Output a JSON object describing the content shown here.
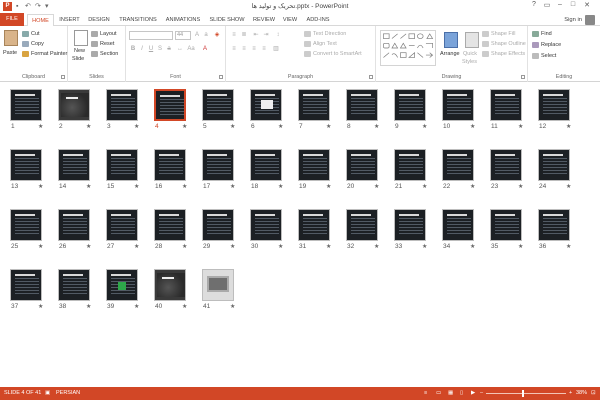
{
  "app": {
    "window_title": "تحریک و تولید ها.pptx - PowerPoint",
    "logo_letter": "P",
    "window_controls": [
      "?",
      "▭",
      "–",
      "□",
      "✕"
    ],
    "qat_icons": [
      "save-icon",
      "undo-icon",
      "redo-icon",
      "customize-icon"
    ],
    "sign_in": "Sign in"
  },
  "tabs": [
    "FILE",
    "HOME",
    "INSERT",
    "DESIGN",
    "TRANSITIONS",
    "ANIMATIONS",
    "SLIDE SHOW",
    "REVIEW",
    "VIEW",
    "ADD-INS"
  ],
  "active_tab": "HOME",
  "ribbon": {
    "clipboard": {
      "label": "Clipboard",
      "paste": "Paste",
      "cut": "Cut",
      "copy": "Copy",
      "format_painter": "Format Painter"
    },
    "slides": {
      "label": "Slides",
      "new_slide_line1": "New",
      "new_slide_line2": "Slide",
      "layout": "Layout",
      "reset": "Reset",
      "section": "Section"
    },
    "font": {
      "label": "Font",
      "size": "44"
    },
    "paragraph": {
      "label": "Paragraph",
      "text_direction": "Text Direction",
      "align_text": "Align Text",
      "convert_smartart": "Convert to SmartArt"
    },
    "drawing": {
      "label": "Drawing",
      "arrange": "Arrange",
      "quick_styles_line1": "Quick",
      "quick_styles_line2": "Styles",
      "shape_fill": "Shape Fill",
      "shape_outline": "Shape Outline",
      "shape_effects": "Shape Effects"
    },
    "editing": {
      "label": "Editing",
      "find": "Find",
      "replace": "Replace",
      "select": "Select"
    }
  },
  "slides": {
    "selected": 4,
    "items": [
      {
        "num": "1",
        "kind": "title"
      },
      {
        "num": "2",
        "kind": "photo"
      },
      {
        "num": "3",
        "kind": "text"
      },
      {
        "num": "4",
        "kind": "text"
      },
      {
        "num": "5",
        "kind": "text"
      },
      {
        "num": "6",
        "kind": "paper"
      },
      {
        "num": "7",
        "kind": "text"
      },
      {
        "num": "8",
        "kind": "text"
      },
      {
        "num": "9",
        "kind": "text"
      },
      {
        "num": "10",
        "kind": "text"
      },
      {
        "num": "11",
        "kind": "text"
      },
      {
        "num": "12",
        "kind": "text"
      },
      {
        "num": "13",
        "kind": "text"
      },
      {
        "num": "14",
        "kind": "text"
      },
      {
        "num": "15",
        "kind": "text"
      },
      {
        "num": "16",
        "kind": "text"
      },
      {
        "num": "17",
        "kind": "text"
      },
      {
        "num": "18",
        "kind": "text"
      },
      {
        "num": "19",
        "kind": "text"
      },
      {
        "num": "20",
        "kind": "text"
      },
      {
        "num": "21",
        "kind": "text"
      },
      {
        "num": "22",
        "kind": "text"
      },
      {
        "num": "23",
        "kind": "text"
      },
      {
        "num": "24",
        "kind": "text"
      },
      {
        "num": "25",
        "kind": "text"
      },
      {
        "num": "26",
        "kind": "text"
      },
      {
        "num": "27",
        "kind": "text"
      },
      {
        "num": "28",
        "kind": "text"
      },
      {
        "num": "29",
        "kind": "text"
      },
      {
        "num": "30",
        "kind": "text"
      },
      {
        "num": "31",
        "kind": "text"
      },
      {
        "num": "32",
        "kind": "text"
      },
      {
        "num": "33",
        "kind": "text"
      },
      {
        "num": "34",
        "kind": "text"
      },
      {
        "num": "35",
        "kind": "text"
      },
      {
        "num": "36",
        "kind": "text"
      },
      {
        "num": "37",
        "kind": "text"
      },
      {
        "num": "38",
        "kind": "text"
      },
      {
        "num": "39",
        "kind": "green"
      },
      {
        "num": "40",
        "kind": "photo"
      },
      {
        "num": "41",
        "kind": "laptop"
      }
    ],
    "star": "★"
  },
  "status": {
    "slide_info": "SLIDE 4 OF 41",
    "language": "PERSIAN",
    "zoom": "38%",
    "zoom_minus": "–",
    "zoom_plus": "+"
  },
  "colors": {
    "accent": "#d24726",
    "slide_bg": "#1c2024"
  }
}
